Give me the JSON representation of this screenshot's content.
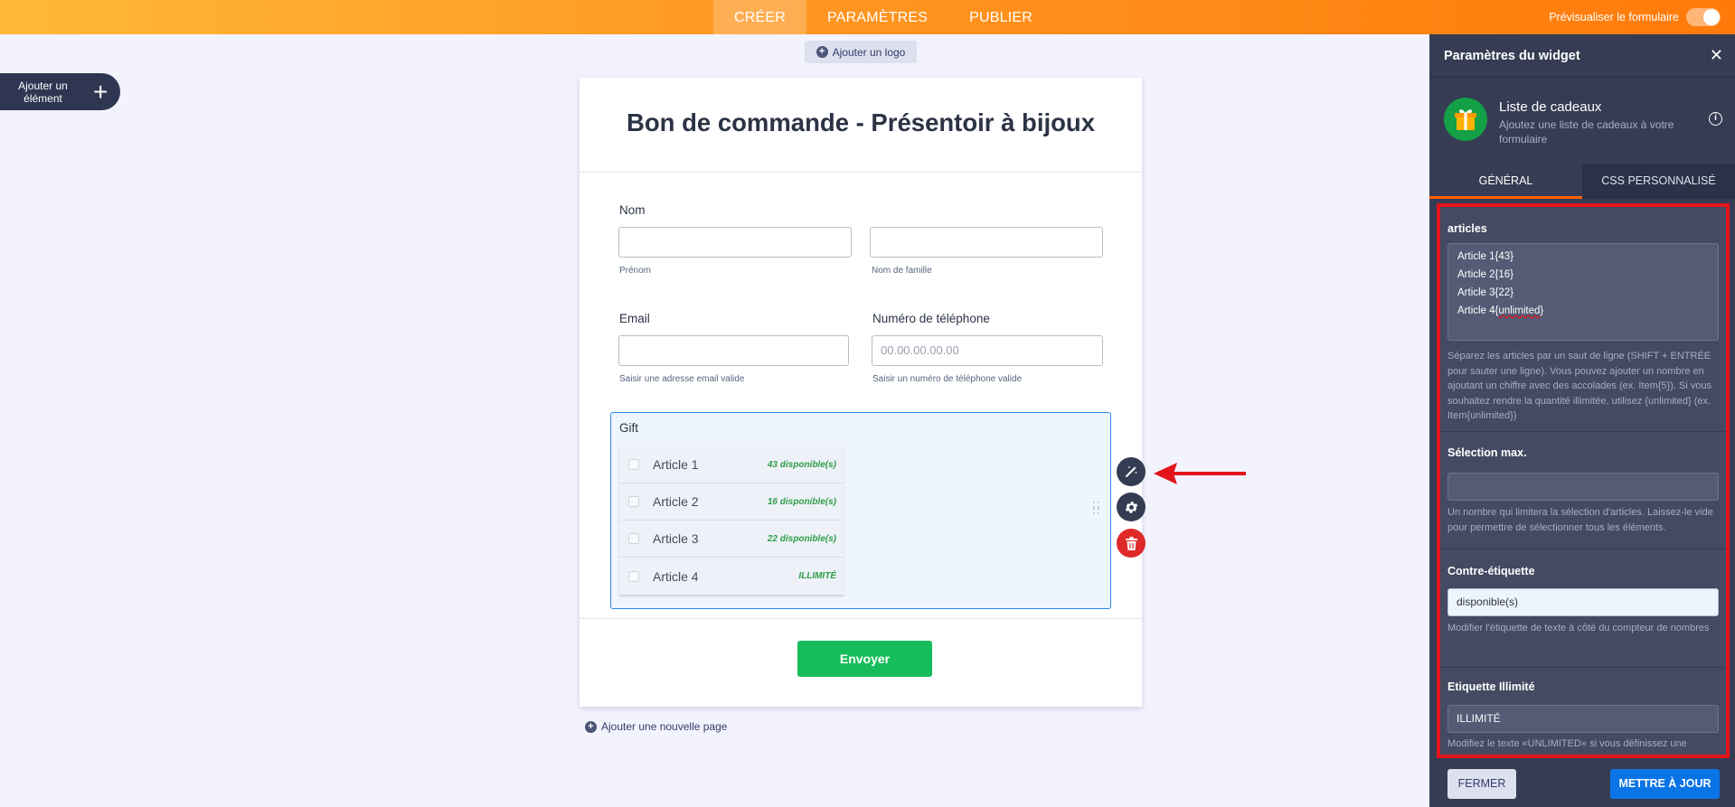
{
  "topbar": {
    "tabs": [
      "CRÉER",
      "PARAMÈTRES",
      "PUBLIER"
    ],
    "preview_label": "Prévisualiser le formulaire"
  },
  "left": {
    "add_element_label": "Ajouter un élément"
  },
  "canvas": {
    "add_logo": "Ajouter un logo",
    "add_page": "Ajouter une nouvelle page"
  },
  "form": {
    "title": "Bon de commande - Présentoir à bijoux",
    "name_label": "Nom",
    "first_name_sub": "Prénom",
    "last_name_sub": "Nom de famille",
    "email_label": "Email",
    "email_sub": "Saisir une adresse email valide",
    "phone_label": "Numéro de téléphone",
    "phone_placeholder": "00.00.00.00.00",
    "phone_sub": "Saisir un numéro de téléphone valide",
    "gift": {
      "title": "Gift",
      "items": [
        {
          "name": "Article 1",
          "count": "43 disponible(s)"
        },
        {
          "name": "Article 2",
          "count": "16 disponible(s)"
        },
        {
          "name": "Article 3",
          "count": "22 disponible(s)"
        },
        {
          "name": "Article 4",
          "count": "ILLIMITÉ"
        }
      ]
    },
    "submit_label": "Envoyer"
  },
  "panel": {
    "title": "Paramètres du widget",
    "widget_name": "Liste de cadeaux",
    "widget_desc": "Ajoutez une liste de cadeaux à votre formulaire",
    "tabs": [
      "GÉNÉRAL",
      "CSS PERSONNALISÉ"
    ],
    "articles": {
      "title": "articles",
      "lines": [
        "Article 1{43}",
        "Article 2{16}",
        "Article 3{22}",
        "Article 4{",
        "unlimited",
        "}"
      ],
      "help": "Séparez les articles par un saut de ligne (SHIFT + ENTRÉE pour sauter une ligne). Vous pouvez ajouter un nombre en ajoutant un chiffre avec des accolades (ex. Item{5}). Si vous souhaitez rendre la quantité illimitée, utilisez {unlimited} (ex. Item{unlimited})"
    },
    "max_selection": {
      "title": "Sélection max.",
      "value": "",
      "help": "Un nombre qui limitera la sélection d'articles. Laissez-le vide pour permettre de sélectionner tous les éléments."
    },
    "counter_label": {
      "title": "Contre-étiquette",
      "value": "disponible(s)",
      "help": "Modifier l'étiquette de texte à côté du compteur de nombres"
    },
    "unlimited_label": {
      "title": "Etiquette Illimité",
      "value": "ILLIMITÉ",
      "help": "Modifiez le texte «UNLIMITED» si vous définissez une"
    },
    "close_label": "FERMER",
    "update_label": "METTRE À JOUR"
  },
  "colors": {
    "accent": "#ff7a0a",
    "highlight": "#e3151a",
    "submit": "#18bd5b",
    "update": "#0a74e6"
  }
}
